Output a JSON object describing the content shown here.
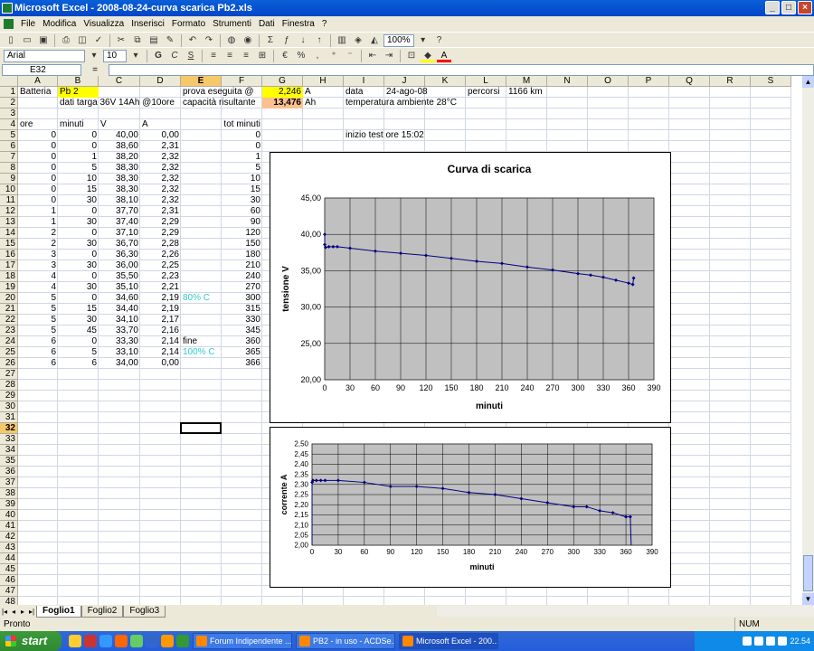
{
  "window": {
    "title": "Microsoft Excel - 2008-08-24-curva scarica Pb2.xls",
    "min": "_",
    "max": "□",
    "close": "×"
  },
  "menu": [
    "File",
    "Modifica",
    "Visualizza",
    "Inserisci",
    "Formato",
    "Strumenti",
    "Dati",
    "Finestra",
    "?"
  ],
  "toolbar1": {
    "zoom": "100%"
  },
  "toolbar2": {
    "font": "Arial",
    "size": "10",
    "bold": "G",
    "italic": "C",
    "underline": "S"
  },
  "formula": {
    "namebox": "E32",
    "fx": "=",
    "content": ""
  },
  "columns": [
    "A",
    "B",
    "C",
    "D",
    "E",
    "F",
    "G",
    "H",
    "I",
    "J",
    "K",
    "L",
    "M",
    "N",
    "O",
    "P",
    "Q",
    "R",
    "S"
  ],
  "rows": [
    "1",
    "2",
    "3",
    "4",
    "5",
    "6",
    "7",
    "8",
    "9",
    "10",
    "11",
    "12",
    "13",
    "14",
    "15",
    "16",
    "17",
    "18",
    "19",
    "20",
    "21",
    "22",
    "23",
    "24",
    "25",
    "26",
    "27",
    "28",
    "29",
    "30",
    "31",
    "32",
    "33",
    "34",
    "35",
    "36",
    "37",
    "38",
    "39",
    "40",
    "41",
    "42",
    "43",
    "44",
    "45",
    "46",
    "47",
    "48",
    "49"
  ],
  "header_cells": {
    "A1": "Batteria",
    "B1": "Pb 2",
    "E1": "prova eseguita @",
    "G1": "2,246",
    "H1": "A",
    "I1": "data",
    "J1": "24-ago-08",
    "L1": "percorsi",
    "M1": "1166 km",
    "B2": "dati targa 36V  14Ah @10ore",
    "E2": "capacità risultante",
    "G2": "13,476",
    "H2": "Ah",
    "I2": "temperatura ambiente 28°C",
    "A4": "ore",
    "B4": "minuti",
    "C4": "V",
    "D4": "A",
    "F4": "tot minuti",
    "I5": "inizio test ore 15:02"
  },
  "table_rows": [
    {
      "ore": "0",
      "min": "0",
      "v": "40,00",
      "a": "0,00",
      "note": "",
      "tot": "0"
    },
    {
      "ore": "0",
      "min": "0",
      "v": "38,60",
      "a": "2,31",
      "note": "",
      "tot": "0"
    },
    {
      "ore": "0",
      "min": "1",
      "v": "38,20",
      "a": "2,32",
      "note": "",
      "tot": "1"
    },
    {
      "ore": "0",
      "min": "5",
      "v": "38,30",
      "a": "2,32",
      "note": "",
      "tot": "5"
    },
    {
      "ore": "0",
      "min": "10",
      "v": "38,30",
      "a": "2,32",
      "note": "",
      "tot": "10"
    },
    {
      "ore": "0",
      "min": "15",
      "v": "38,30",
      "a": "2,32",
      "note": "",
      "tot": "15"
    },
    {
      "ore": "0",
      "min": "30",
      "v": "38,10",
      "a": "2,32",
      "note": "",
      "tot": "30"
    },
    {
      "ore": "1",
      "min": "0",
      "v": "37,70",
      "a": "2,31",
      "note": "",
      "tot": "60"
    },
    {
      "ore": "1",
      "min": "30",
      "v": "37,40",
      "a": "2,29",
      "note": "",
      "tot": "90"
    },
    {
      "ore": "2",
      "min": "0",
      "v": "37,10",
      "a": "2,29",
      "note": "",
      "tot": "120"
    },
    {
      "ore": "2",
      "min": "30",
      "v": "36,70",
      "a": "2,28",
      "note": "",
      "tot": "150"
    },
    {
      "ore": "3",
      "min": "0",
      "v": "36,30",
      "a": "2,26",
      "note": "",
      "tot": "180"
    },
    {
      "ore": "3",
      "min": "30",
      "v": "36,00",
      "a": "2,25",
      "note": "",
      "tot": "210"
    },
    {
      "ore": "4",
      "min": "0",
      "v": "35,50",
      "a": "2,23",
      "note": "",
      "tot": "240"
    },
    {
      "ore": "4",
      "min": "30",
      "v": "35,10",
      "a": "2,21",
      "note": "",
      "tot": "270"
    },
    {
      "ore": "5",
      "min": "0",
      "v": "34,60",
      "a": "2,19",
      "note": "80% C",
      "tot": "300"
    },
    {
      "ore": "5",
      "min": "15",
      "v": "34,40",
      "a": "2,19",
      "note": "",
      "tot": "315"
    },
    {
      "ore": "5",
      "min": "30",
      "v": "34,10",
      "a": "2,17",
      "note": "",
      "tot": "330"
    },
    {
      "ore": "5",
      "min": "45",
      "v": "33,70",
      "a": "2,16",
      "note": "",
      "tot": "345"
    },
    {
      "ore": "6",
      "min": "0",
      "v": "33,30",
      "a": "2,14",
      "note": "fine",
      "tot": "360"
    },
    {
      "ore": "6",
      "min": "5",
      "v": "33,10",
      "a": "2,14",
      "note": "100% C",
      "tot": "365"
    },
    {
      "ore": "6",
      "min": "6",
      "v": "34,00",
      "a": "0,00",
      "note": "",
      "tot": "366"
    }
  ],
  "chart_data": [
    {
      "type": "line",
      "title": "Curva di scarica",
      "xlabel": "minuti",
      "ylabel": "tensione V",
      "xlim": [
        0,
        390
      ],
      "ylim": [
        20,
        45
      ],
      "xticks": [
        "0",
        "30",
        "60",
        "90",
        "120",
        "150",
        "180",
        "210",
        "240",
        "270",
        "300",
        "330",
        "360",
        "390"
      ],
      "yticks": [
        "20,00",
        "25,00",
        "30,00",
        "35,00",
        "40,00",
        "45,00"
      ],
      "grid": true,
      "x": [
        0,
        0,
        1,
        5,
        10,
        15,
        30,
        60,
        90,
        120,
        150,
        180,
        210,
        240,
        270,
        300,
        315,
        330,
        345,
        360,
        365,
        366
      ],
      "values": [
        40.0,
        38.6,
        38.2,
        38.3,
        38.3,
        38.3,
        38.1,
        37.7,
        37.4,
        37.1,
        36.7,
        36.3,
        36.0,
        35.5,
        35.1,
        34.6,
        34.4,
        34.1,
        33.7,
        33.3,
        33.1,
        34.0
      ],
      "color": "#000080",
      "plot_bg": "#c0c0c0"
    },
    {
      "type": "line",
      "title": "",
      "xlabel": "minuti",
      "ylabel": "corrente A",
      "xlim": [
        0,
        390
      ],
      "ylim": [
        2.0,
        2.5
      ],
      "xticks": [
        "0",
        "30",
        "60",
        "90",
        "120",
        "150",
        "180",
        "210",
        "240",
        "270",
        "300",
        "330",
        "360",
        "390"
      ],
      "yticks": [
        "2,00",
        "2,05",
        "2,10",
        "2,15",
        "2,20",
        "2,25",
        "2,30",
        "2,35",
        "2,40",
        "2,45",
        "2,50"
      ],
      "grid": true,
      "x": [
        0,
        0,
        1,
        5,
        10,
        15,
        30,
        60,
        90,
        120,
        150,
        180,
        210,
        240,
        270,
        300,
        315,
        330,
        345,
        360,
        365,
        366
      ],
      "values": [
        0.0,
        2.31,
        2.32,
        2.32,
        2.32,
        2.32,
        2.32,
        2.31,
        2.29,
        2.29,
        2.28,
        2.26,
        2.25,
        2.23,
        2.21,
        2.19,
        2.19,
        2.17,
        2.16,
        2.14,
        2.14,
        0.0
      ],
      "color": "#000080",
      "plot_bg": "#c0c0c0"
    }
  ],
  "sheets": [
    "Foglio1",
    "Foglio2",
    "Foglio3"
  ],
  "status": {
    "left": "Pronto",
    "num": "NUM"
  },
  "taskbar": {
    "start": "start",
    "tasks": [
      "Forum Indipendente ...",
      "PB2 - in uso - ACDSe...",
      "Microsoft Excel - 200..."
    ],
    "clock": "22.54"
  }
}
